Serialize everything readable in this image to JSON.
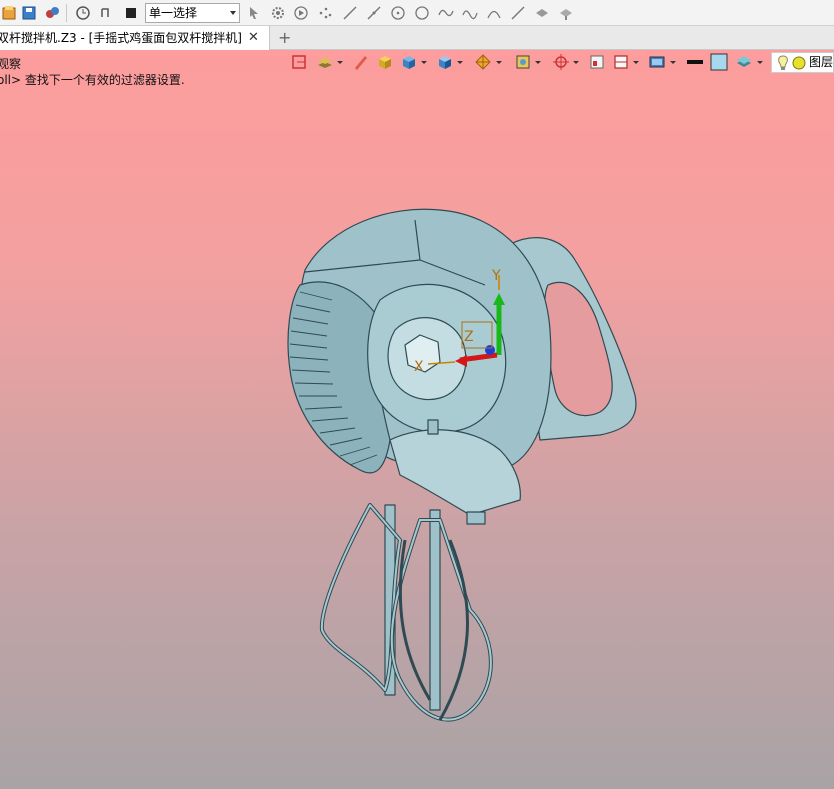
{
  "toolbar": {
    "selection_mode": "单一选择",
    "icons": [
      "new-file-icon",
      "save-icon",
      "settings-icon",
      "history-icon",
      "undo-icon",
      "stop-icon",
      "cursor-icon",
      "gear-select-icon",
      "play-icon",
      "points-icon",
      "line-icon",
      "line2-icon",
      "circle-dot-icon",
      "circle-icon",
      "curve-icon",
      "arc-icon",
      "line3-icon",
      "fill-icon",
      "paint-icon"
    ]
  },
  "tab": {
    "title": "双杆搅拌机.Z3 - [手摇式鸡蛋面包双杆搅拌机]",
    "close_symbol": "✕",
    "add_symbol": "+"
  },
  "viewport": {
    "mode_text": "观察",
    "hint_text": "oll> 查找下一个有效的过滤器设置.",
    "layer_label": "图层",
    "background_top": "#fd9d9d",
    "background_bottom": "#a9a3a6",
    "model_color": "#9bc0c8",
    "axes": {
      "x": "X",
      "y": "Y",
      "z": "Z"
    }
  }
}
